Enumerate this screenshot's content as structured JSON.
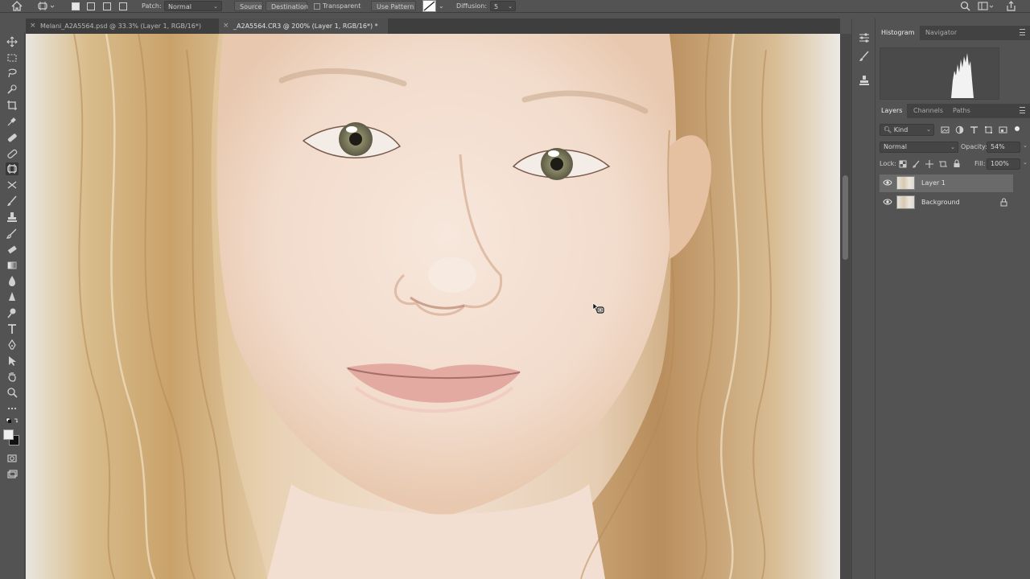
{
  "options_bar": {
    "patch_label": "Patch:",
    "patch_mode": "Normal",
    "source_label": "Source",
    "destination_label": "Destination",
    "transparent_label": "Transparent",
    "use_pattern_label": "Use Pattern",
    "diffusion_label": "Diffusion:",
    "diffusion_value": "5"
  },
  "tabs": [
    {
      "label": "Melani_A2A5564.psd @ 33.3% (Layer 1, RGB/16*)",
      "active": false
    },
    {
      "label": "_A2A5564.CR3 @ 200% (Layer 1, RGB/16*) *",
      "active": true
    }
  ],
  "panels": {
    "top_tabs": [
      "Histogram",
      "Navigator"
    ],
    "layer_tabs": [
      "Layers",
      "Channels",
      "Paths"
    ],
    "filter_kind": "Kind",
    "blend_mode": "Normal",
    "opacity_label": "Opacity:",
    "opacity_value": "54%",
    "lock_label": "Lock:",
    "fill_label": "Fill:",
    "fill_value": "100%",
    "layers": [
      {
        "name": "Layer 1",
        "selected": true,
        "locked": false
      },
      {
        "name": "Background",
        "selected": false,
        "locked": true
      }
    ]
  },
  "colors": {
    "ui_bg": "#535353",
    "panel_dark": "#424242",
    "selected_layer": "#6a6a6a",
    "foreground_color": "#f0f0f0",
    "background_color": "#111111"
  }
}
